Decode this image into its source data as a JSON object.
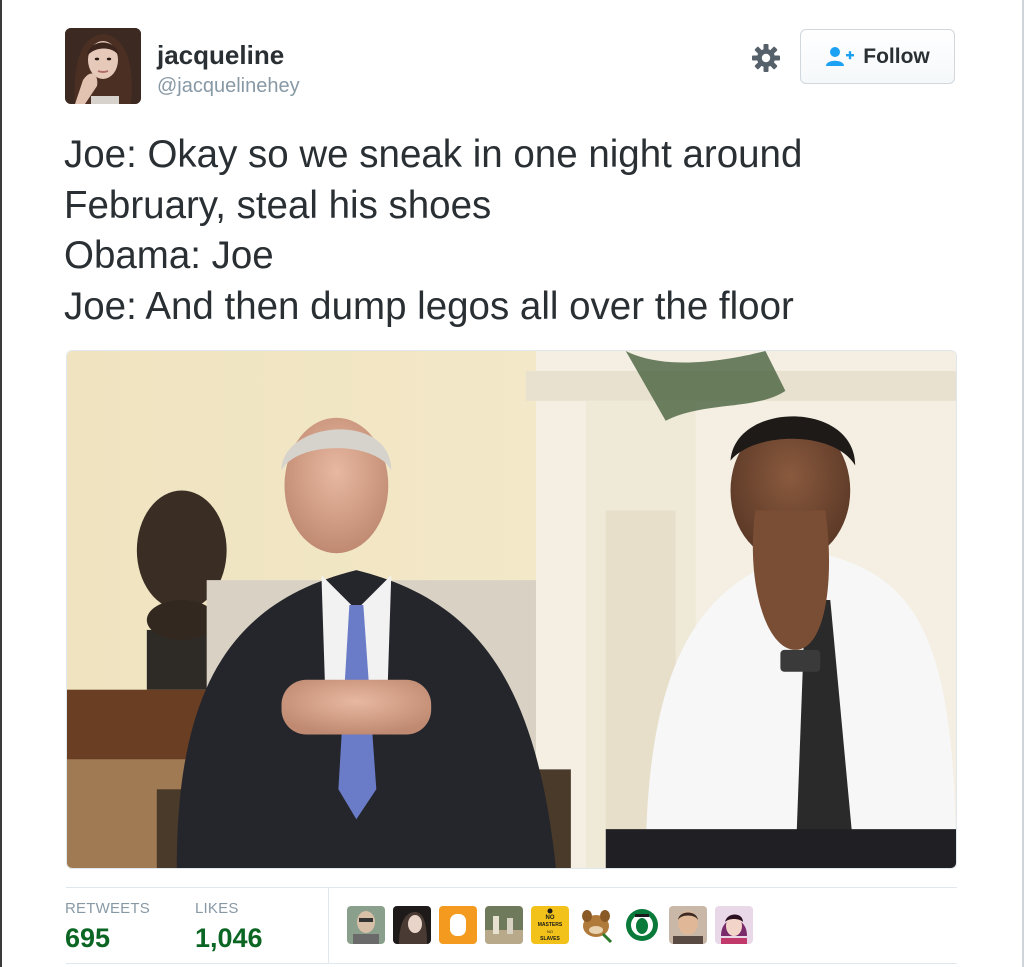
{
  "user": {
    "name": "jacqueline",
    "handle": "@jacquelinehey"
  },
  "actions": {
    "follow_label": "Follow",
    "settings_icon": "gear-icon",
    "follow_icon": "add-user-icon"
  },
  "tweet": {
    "lines": [
      "Joe: Okay so we sneak in one night around",
      "February, steal his shoes",
      "Obama: Joe",
      "Joe: And then dump legos all over the floor"
    ]
  },
  "stats": {
    "retweets_label": "RETWEETS",
    "retweets_value": "695",
    "likes_label": "LIKES",
    "likes_value": "1,046"
  },
  "likers": {
    "poster_top": "NO",
    "poster_middle": "MASTERS",
    "poster_small": "NO",
    "poster_bottom": "SLAVES"
  },
  "colors": {
    "text": "#292f33",
    "muted": "#8899a6",
    "count_green": "#0b6623",
    "follow_blue": "#1da1f2"
  }
}
